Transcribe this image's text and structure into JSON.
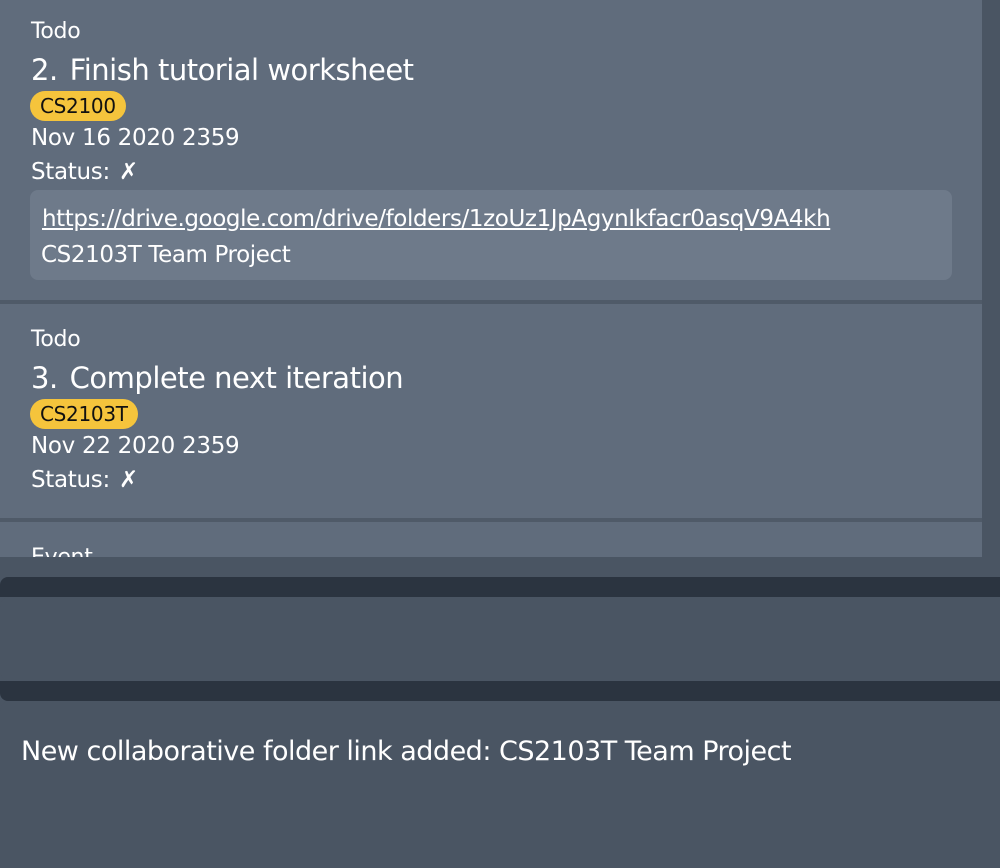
{
  "tasks": [
    {
      "type": "Todo",
      "index": "2.",
      "title": "Finish tutorial worksheet",
      "tag": "CS2100",
      "date": "Nov 16 2020 2359",
      "status_label": "Status:",
      "status_mark": "✗",
      "link": {
        "url": "https://drive.google.com/drive/folders/1zoUz1JpAgynIkfacr0asqV9A4kh",
        "name": "CS2103T Team Project"
      }
    },
    {
      "type": "Todo",
      "index": "3.",
      "title": "Complete next iteration",
      "tag": "CS2103T",
      "date": "Nov 22 2020 2359",
      "status_label": "Status:",
      "status_mark": "✗"
    },
    {
      "type": "Event"
    }
  ],
  "command_box": {
    "value": "",
    "placeholder": ""
  },
  "result": {
    "message": "New collaborative folder link added: CS2103T Team Project"
  },
  "colors": {
    "card_bg": "#606c7c",
    "tag_bg": "#f5c43c",
    "link_box_bg": "#6e7a8a",
    "panel_bg": "#4a5563",
    "divider": "#2b3440"
  }
}
